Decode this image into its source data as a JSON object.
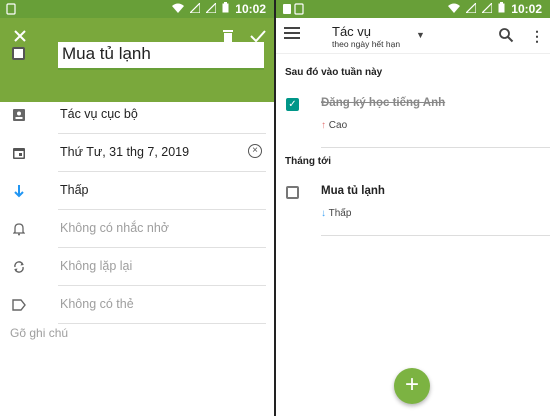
{
  "status_bar": {
    "time": "10:02"
  },
  "edit": {
    "title_value": "Mua tủ lạnh",
    "list_name": "Tác vụ cục bộ",
    "due_date": "Thứ Tư, 31 thg 7, 2019",
    "priority": "Thấp",
    "reminder": "Không có nhắc nhở",
    "repeat": "Không lặp lại",
    "tags": "Không có thẻ",
    "notes_placeholder": "Gõ ghi chú"
  },
  "list": {
    "title": "Tác vụ",
    "subtitle": "theo ngày hết hạn",
    "sections": [
      {
        "header": "Sau đó vào tuần này",
        "tasks": [
          {
            "name": "Đăng ký học tiếng Anh",
            "priority_arrow": "↑",
            "priority": "Cao",
            "completed": true
          }
        ]
      },
      {
        "header": "Tháng tới",
        "tasks": [
          {
            "name": "Mua tủ lạnh",
            "priority_arrow": "↓",
            "priority": "Thấp",
            "completed": false
          }
        ]
      }
    ],
    "fab_label": "+"
  },
  "colors": {
    "primary": "#7aa83c",
    "statusbar": "#689f38",
    "accent": "#009688",
    "fab": "#7cb342",
    "high_priority": "#e57373",
    "low_priority": "#42a5f5"
  }
}
